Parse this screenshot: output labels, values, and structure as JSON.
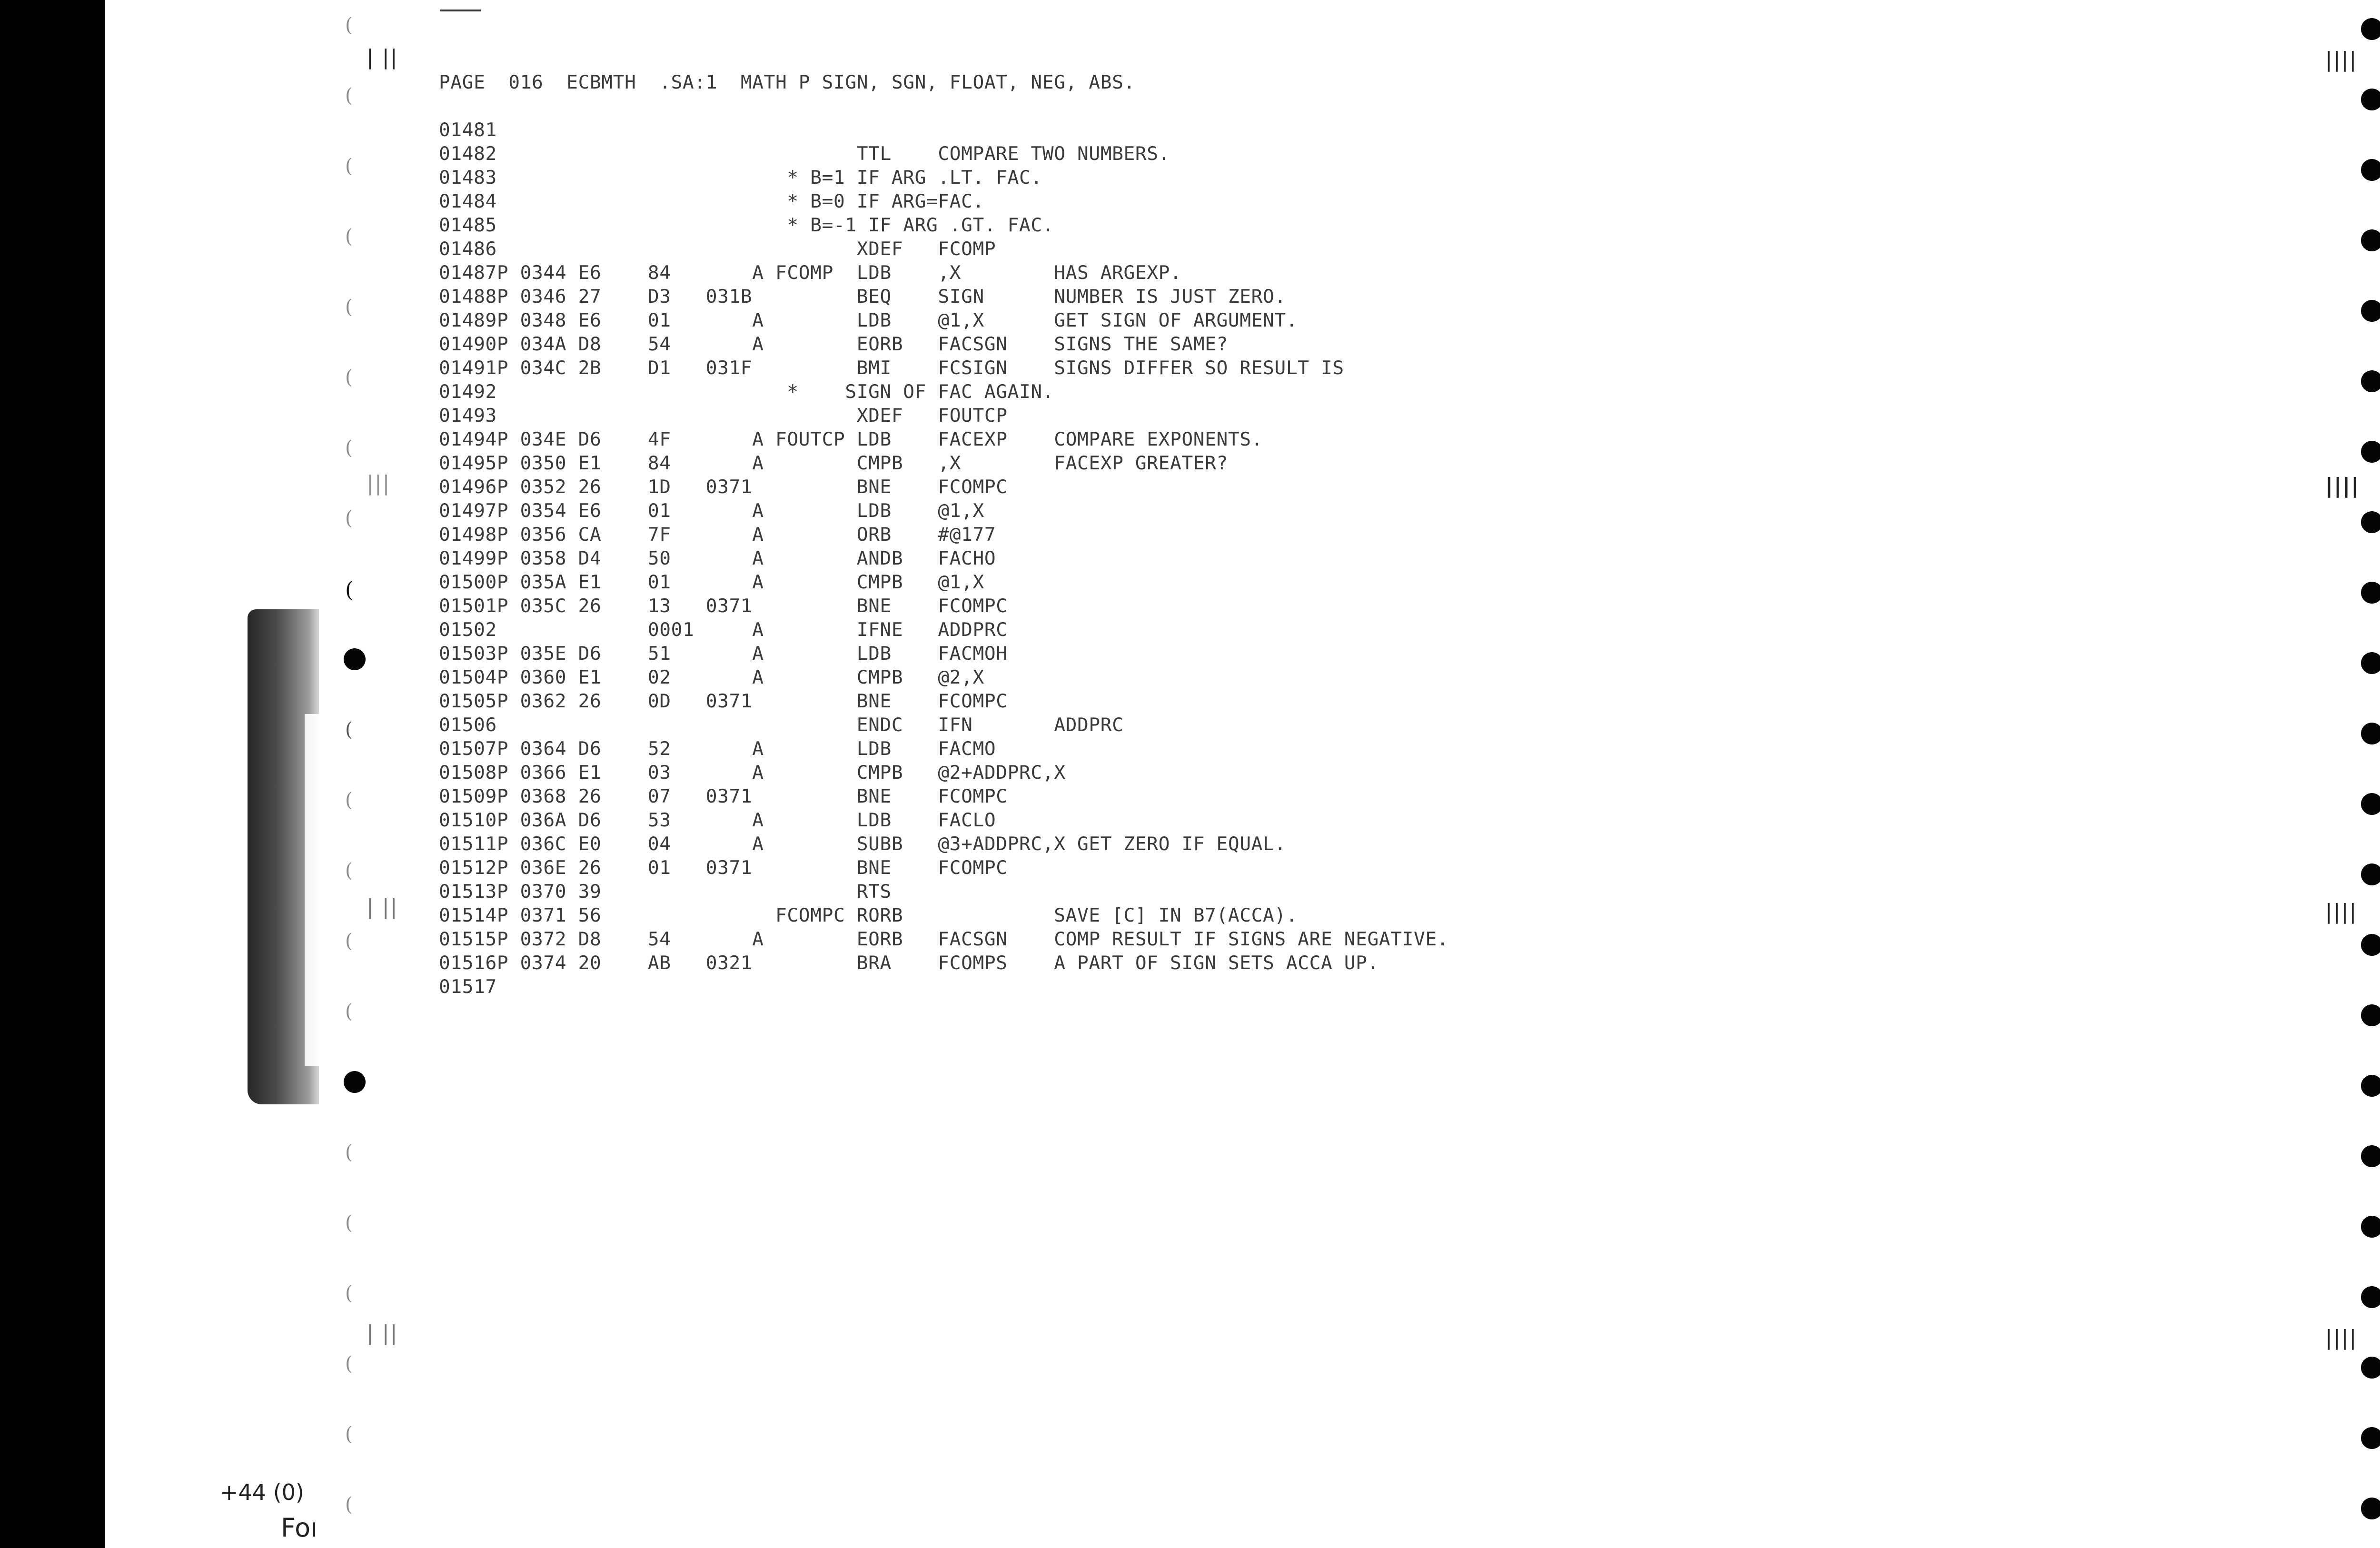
{
  "document": {
    "header": "PAGE  016  ECBMTH  .SA:1  MATH P SIGN, SGN, FLOAT, NEG, ABS.",
    "lines": [
      "01481",
      "01482                               TTL    COMPARE TWO NUMBERS.",
      "01483                         * B=1 IF ARG .LT. FAC.",
      "01484                         * B=0 IF ARG=FAC.",
      "01485                         * B=-1 IF ARG .GT. FAC.",
      "01486                               XDEF   FCOMP",
      "01487P 0344 E6    84       A FCOMP  LDB    ,X        HAS ARGEXP.",
      "01488P 0346 27    D3   031B         BEQ    SIGN      NUMBER IS JUST ZERO.",
      "01489P 0348 E6    01       A        LDB    @1,X      GET SIGN OF ARGUMENT.",
      "01490P 034A D8    54       A        EORB   FACSGN    SIGNS THE SAME?",
      "01491P 034C 2B    D1   031F         BMI    FCSIGN    SIGNS DIFFER SO RESULT IS",
      "01492                         *    SIGN OF FAC AGAIN.",
      "01493                               XDEF   FOUTCP",
      "01494P 034E D6    4F       A FOUTCP LDB    FACEXP    COMPARE EXPONENTS.",
      "01495P 0350 E1    84       A        CMPB   ,X        FACEXP GREATER?",
      "01496P 0352 26    1D   0371         BNE    FCOMPC",
      "01497P 0354 E6    01       A        LDB    @1,X",
      "01498P 0356 CA    7F       A        ORB    #@177",
      "01499P 0358 D4    50       A        ANDB   FACHO",
      "01500P 035A E1    01       A        CMPB   @1,X",
      "01501P 035C 26    13   0371         BNE    FCOMPC",
      "01502             0001     A        IFNE   ADDPRC",
      "01503P 035E D6    51       A        LDB    FACMOH",
      "01504P 0360 E1    02       A        CMPB   @2,X",
      "01505P 0362 26    0D   0371         BNE    FCOMPC",
      "01506                               ENDC   IFN       ADDPRC",
      "01507P 0364 D6    52       A        LDB    FACMO",
      "01508P 0366 E1    03       A        CMPB   @2+ADDPRC,X",
      "01509P 0368 26    07   0371         BNE    FCOMPC",
      "01510P 036A D6    53       A        LDB    FACLO",
      "01511P 036C E0    04       A        SUBB   @3+ADDPRC,X GET ZERO IF EQUAL.",
      "01512P 036E 26    01   0371         BNE    FCOMPC",
      "01513P 0370 39                      RTS",
      "01514P 0371 56               FCOMPC RORB             SAVE [C] IN B7(ACCA).",
      "01515P 0372 D8    54       A        EORB   FACSGN    COMP RESULT IF SIGNS ARE NEGATIVE.",
      "01516P 0374 20    AB   0321         BRA    FCOMPS    A PART OF SIGN SETS ACCA UP.",
      "01517"
    ],
    "margin_text": {
      "phone_fragment": "+44 (0)",
      "fo_fragment": "Foı"
    }
  }
}
